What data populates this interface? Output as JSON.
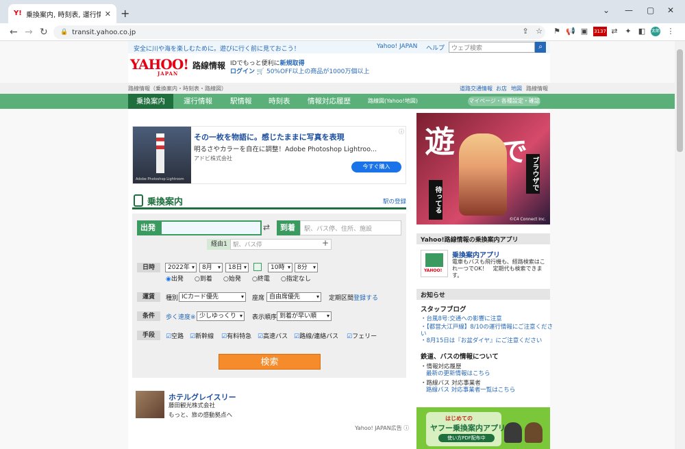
{
  "browser": {
    "tab_title": "乗換案内, 時刻表, 運行情報 - Ya",
    "url": "transit.yahoo.co.jp",
    "badge_count": "3137",
    "profile": "太郎"
  },
  "header": {
    "top_message": "安全に川や海を楽しむために。遊びに行く前に見ておこう！",
    "yahoo_japan": "Yahoo! JAPAN",
    "help": "ヘルプ",
    "search_placeholder": "ウェブ検索",
    "logo": "YAHOO!",
    "logo_sub": "JAPAN",
    "site_name": "路線情報",
    "id_text": "IDでもっと便利に",
    "id_link": "新規取得",
    "login": "ログイン",
    "promo": "50%OFF以上の商品が1000万個以上"
  },
  "breadcrumb": "路線情報（乗換案内・時刻表・路線図）",
  "right_links": [
    "道路交通情報",
    "お店",
    "地図",
    "路線情報"
  ],
  "nav": {
    "items": [
      "乗換案内",
      "運行情報",
      "駅情報",
      "時刻表",
      "情報対応履歴",
      "路線図(Yahoo!地図)"
    ],
    "mypage": "マイページ・各種設定・確認"
  },
  "ad": {
    "title": "その一枚を物語に。感じたままに写真を表現",
    "text": "明るさやカラーを自在に調整！Adobe Photoshop Lightroo...",
    "company": "アドビ株式会社",
    "button": "今すぐ購入",
    "img_caption": "Adobe Photoshop Lightroom"
  },
  "transit": {
    "heading": "乗換案内",
    "register": "駅の登録",
    "from_label": "出発",
    "to_label": "到着",
    "to_placeholder": "駅、バス停、住所、施設",
    "via_label": "経由1",
    "via_placeholder": "駅、バス停",
    "datetime_label": "日時",
    "year": "2022年",
    "month": "8月",
    "day": "18日",
    "hour": "10時",
    "minute": "8分",
    "time_options": [
      "出発",
      "到着",
      "始発",
      "終電",
      "指定なし"
    ],
    "fare_label": "運賃",
    "type_label": "種別",
    "type_value": "ICカード優先",
    "seat_label": "座席",
    "seat_value": "自由席優先",
    "commuter_label": "定期区間",
    "commuter_link": "登録する",
    "cond_label": "条件",
    "walk_label": "歩く速度※",
    "walk_value": "少しゆっくり",
    "order_label": "表示順序",
    "order_value": "到着が早い順",
    "means_label": "手段",
    "means": [
      "空路",
      "新幹線",
      "有料特急",
      "高速バス",
      "路線/連絡バス",
      "フェリー"
    ],
    "search_button": "検索"
  },
  "hotel": {
    "title": "ホテルグレイスリー",
    "company": "藤田観光株式会社",
    "desc": "もっと、旅の感動拠点へ",
    "ad_label": "Yahoo! JAPAN広告"
  },
  "sidebar": {
    "banner_big1": "遊",
    "banner_big2": "で",
    "banner_v1": "ブラウザで",
    "banner_v2": "待ってる",
    "banner_copy": "©C4 Connect Inc.",
    "app_head": "Yahoo!路線情報の乗換案内アプリ",
    "app_title": "乗換案内アプリ",
    "app_desc": "電車もバスも飛行機も、経路検索はこれ一つでOK！　定期代も検索できます。",
    "app_icon_text": "YAHOO!",
    "notice_head": "お知らせ",
    "staff_blog": "スタッフブログ",
    "blog_items": [
      "・台風8号:交通への影響に注意",
      "・【都営大江戸線】8/10の運行情報にご注意くださ",
      "い",
      "・8月15日は『お盆ダイヤ』にご注意ください"
    ],
    "rail_bus_head": "鉄道、バスの情報について",
    "info_history": "・情報対応履歴",
    "info_history_link": "最新の更新情報はこちら",
    "bus_ops": "・路線バス 対応事業者",
    "bus_ops_link": "路線バス 対応事業者一覧はこちら",
    "green_t1": "はじめての",
    "green_t2": "ヤフー乗換案内アプリ",
    "green_t3": "使い方PDF配布中"
  }
}
